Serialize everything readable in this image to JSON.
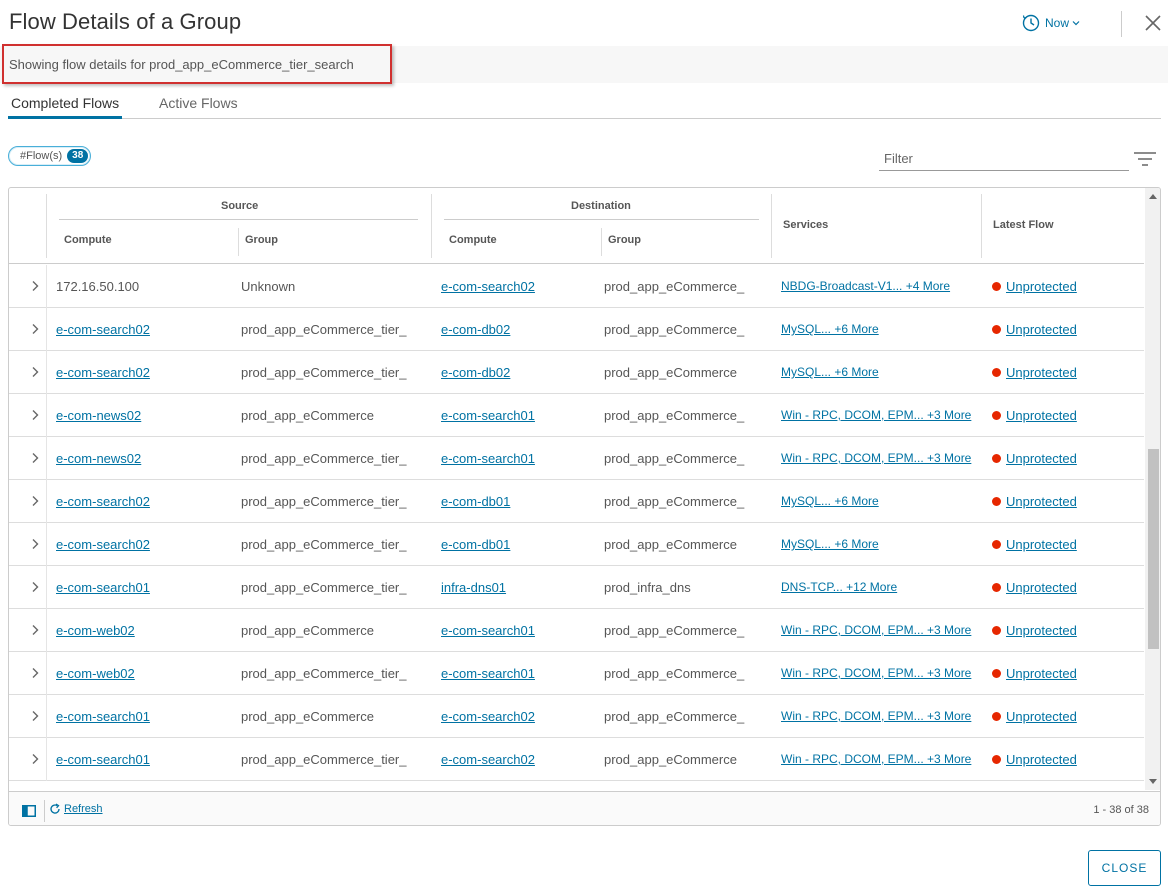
{
  "dialog": {
    "title": "Flow Details of a Group",
    "time_label": "Now",
    "info_text": "Showing flow details for prod_app_eCommerce_tier_search",
    "close_button": "CLOSE"
  },
  "tabs": [
    {
      "label": "Completed Flows",
      "active": true
    },
    {
      "label": "Active Flows",
      "active": false
    }
  ],
  "flows_badge": {
    "label": "#Flow(s)",
    "count": "38"
  },
  "filter": {
    "placeholder": "Filter"
  },
  "grid": {
    "headers": {
      "source": "Source",
      "destination": "Destination",
      "compute": "Compute",
      "group": "Group",
      "services": "Services",
      "latest_flow": "Latest Flow"
    },
    "rows": [
      {
        "src": "172.16.50.100",
        "src_link": false,
        "src_group": "Unknown",
        "dst": "e-com-search02",
        "dst_group": "prod_app_eCommerce_",
        "services": "NBDG-Broadcast-V1... +4 More",
        "latest": "Unprotected"
      },
      {
        "src": "e-com-search02",
        "src_link": true,
        "src_group": "prod_app_eCommerce_tier_",
        "dst": "e-com-db02",
        "dst_group": "prod_app_eCommerce_",
        "services": "MySQL... +6 More",
        "latest": "Unprotected"
      },
      {
        "src": "e-com-search02",
        "src_link": true,
        "src_group": "prod_app_eCommerce_tier_",
        "dst": "e-com-db02",
        "dst_group": "prod_app_eCommerce",
        "services": "MySQL... +6 More",
        "latest": "Unprotected"
      },
      {
        "src": "e-com-news02",
        "src_link": true,
        "src_group": "prod_app_eCommerce",
        "dst": "e-com-search01",
        "dst_group": "prod_app_eCommerce_",
        "services": "Win - RPC, DCOM, EPM... +3 More",
        "latest": "Unprotected"
      },
      {
        "src": "e-com-news02",
        "src_link": true,
        "src_group": "prod_app_eCommerce_tier_",
        "dst": "e-com-search01",
        "dst_group": "prod_app_eCommerce_",
        "services": "Win - RPC, DCOM, EPM... +3 More",
        "latest": "Unprotected"
      },
      {
        "src": "e-com-search02",
        "src_link": true,
        "src_group": "prod_app_eCommerce_tier_",
        "dst": "e-com-db01",
        "dst_group": "prod_app_eCommerce_",
        "services": "MySQL... +6 More",
        "latest": "Unprotected"
      },
      {
        "src": "e-com-search02",
        "src_link": true,
        "src_group": "prod_app_eCommerce_tier_",
        "dst": "e-com-db01",
        "dst_group": "prod_app_eCommerce",
        "services": "MySQL... +6 More",
        "latest": "Unprotected"
      },
      {
        "src": "e-com-search01",
        "src_link": true,
        "src_group": "prod_app_eCommerce_tier_",
        "dst": "infra-dns01",
        "dst_group": "prod_infra_dns",
        "services": "DNS-TCP... +12 More",
        "latest": "Unprotected"
      },
      {
        "src": "e-com-web02",
        "src_link": true,
        "src_group": "prod_app_eCommerce",
        "dst": "e-com-search01",
        "dst_group": "prod_app_eCommerce_",
        "services": "Win - RPC, DCOM, EPM... +3 More",
        "latest": "Unprotected"
      },
      {
        "src": "e-com-web02",
        "src_link": true,
        "src_group": "prod_app_eCommerce_tier_",
        "dst": "e-com-search01",
        "dst_group": "prod_app_eCommerce_",
        "services": "Win - RPC, DCOM, EPM... +3 More",
        "latest": "Unprotected"
      },
      {
        "src": "e-com-search01",
        "src_link": true,
        "src_group": "prod_app_eCommerce",
        "dst": "e-com-search02",
        "dst_group": "prod_app_eCommerce_",
        "services": "Win - RPC, DCOM, EPM... +3 More",
        "latest": "Unprotected"
      },
      {
        "src": "e-com-search01",
        "src_link": true,
        "src_group": "prod_app_eCommerce_tier_",
        "dst": "e-com-search02",
        "dst_group": "prod_app_eCommerce",
        "services": "Win - RPC, DCOM, EPM... +3 More",
        "latest": "Unprotected"
      }
    ],
    "footer": {
      "refresh_label": "Refresh",
      "pagination": "1 - 38 of 38"
    }
  },
  "colors": {
    "accent": "#0072a3",
    "status_unprotected": "#e62700",
    "highlight_border": "#d0302f"
  },
  "icons": [
    "clock-icon",
    "chevron-down-icon",
    "close-icon",
    "filter-icon",
    "chevron-right-icon",
    "column-toggle-icon",
    "refresh-icon"
  ]
}
